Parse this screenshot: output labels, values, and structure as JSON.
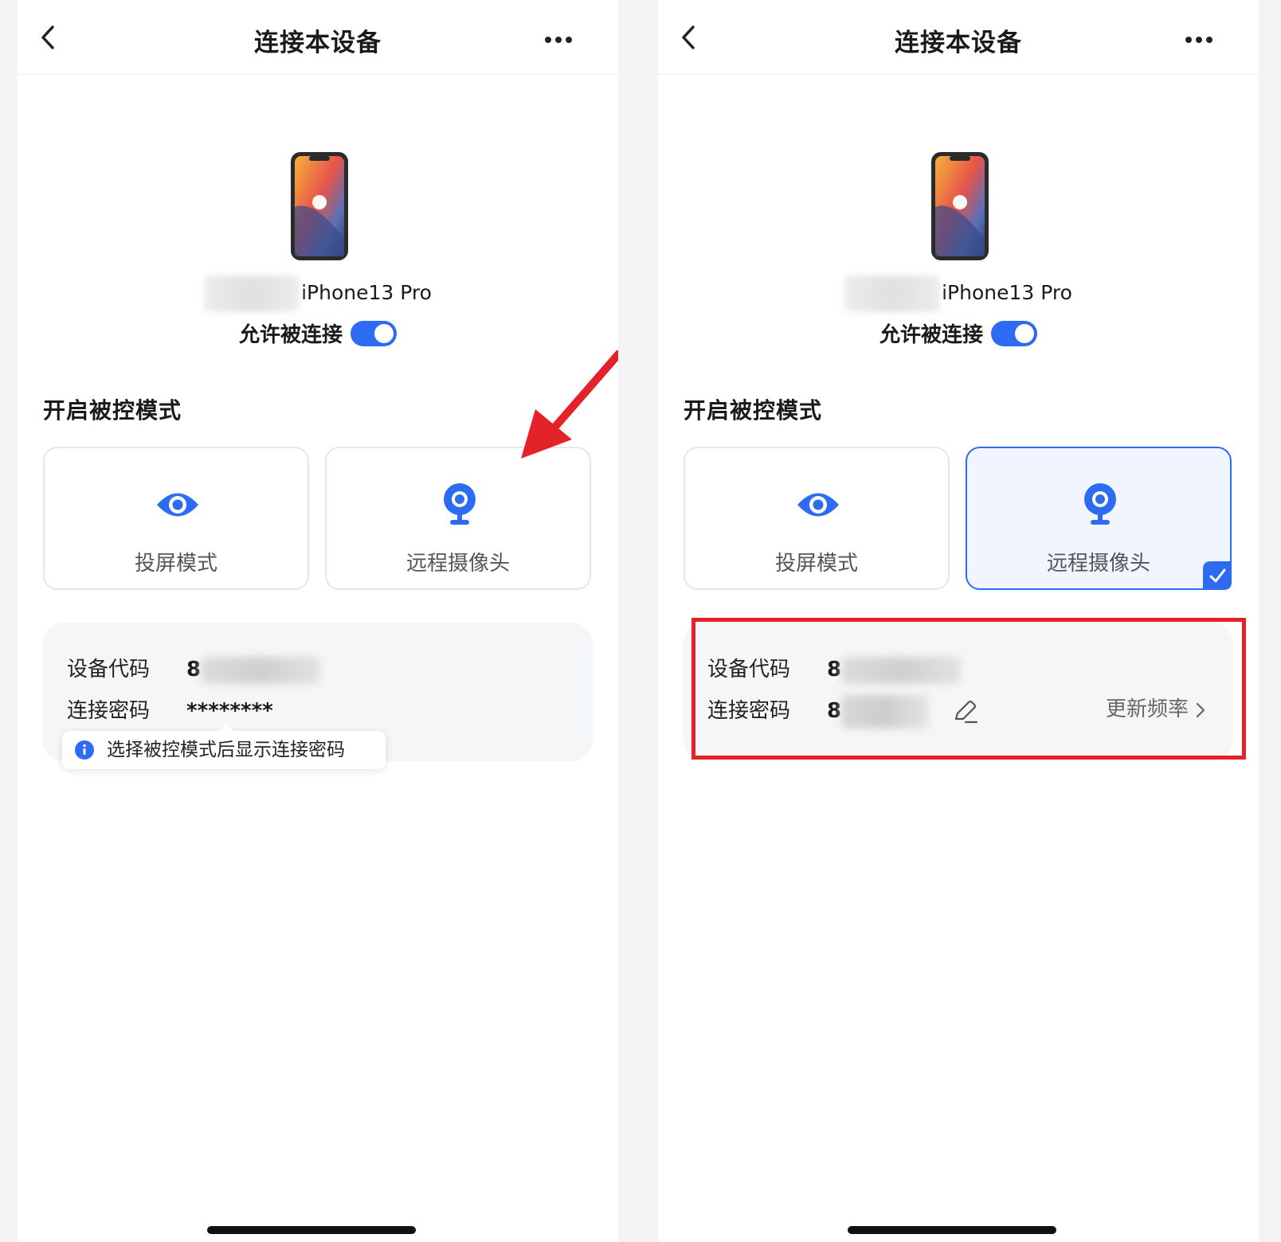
{
  "screens": [
    {
      "nav": {
        "title": "连接本设备"
      },
      "device": {
        "name": "iPhone13 Pro"
      },
      "allow": {
        "label": "允许被连接",
        "enabled": true
      },
      "section_title": "开启被控模式",
      "modes": [
        {
          "label": "投屏模式",
          "selected": false,
          "icon": "eye-icon"
        },
        {
          "label": "远程摄像头",
          "selected": false,
          "icon": "webcam-icon"
        }
      ],
      "info": {
        "device_code_label": "设备代码",
        "device_code_value": "8",
        "password_label": "连接密码",
        "password_value": "********"
      },
      "tooltip": {
        "text": "选择被控模式后显示连接密码"
      }
    },
    {
      "nav": {
        "title": "连接本设备"
      },
      "device": {
        "name": "iPhone13 Pro"
      },
      "allow": {
        "label": "允许被连接",
        "enabled": true
      },
      "section_title": "开启被控模式",
      "modes": [
        {
          "label": "投屏模式",
          "selected": false,
          "icon": "eye-icon"
        },
        {
          "label": "远程摄像头",
          "selected": true,
          "icon": "webcam-icon"
        }
      ],
      "info": {
        "device_code_label": "设备代码",
        "device_code_value": "8",
        "password_label": "连接密码",
        "password_value": "8",
        "update_frequency_label": "更新频率"
      }
    }
  ],
  "colors": {
    "accent": "#2d6bf2",
    "annotation_red": "#e3222a"
  }
}
